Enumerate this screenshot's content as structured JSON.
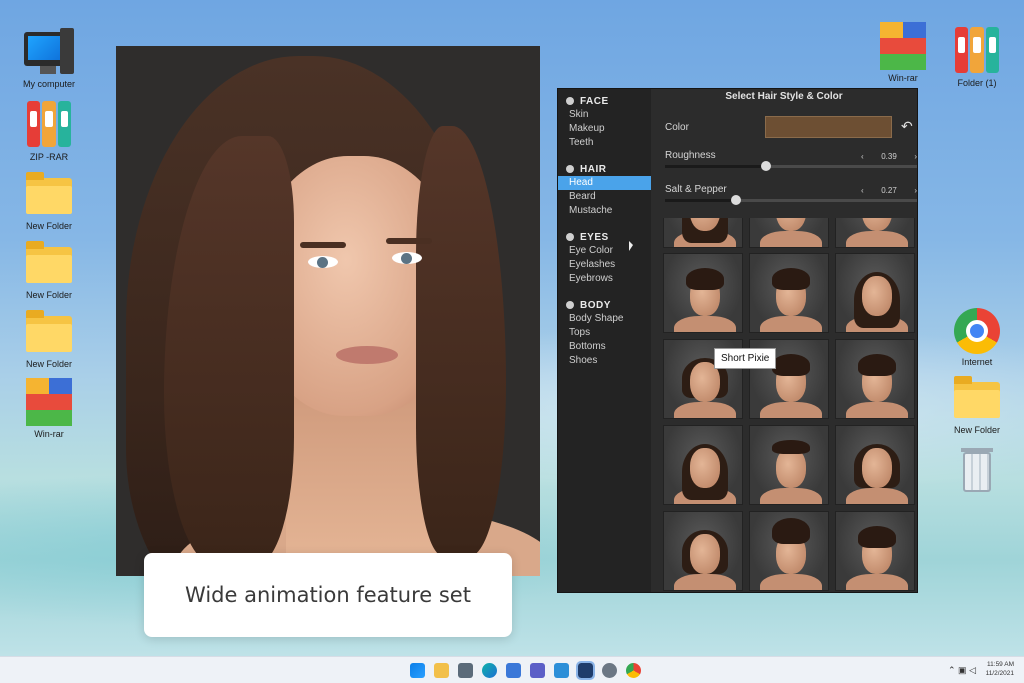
{
  "desktop": {
    "icons_left": [
      {
        "label": "My computer",
        "icon": "computer-icon"
      },
      {
        "label": "ZIP -RAR",
        "icon": "archive-books-icon"
      },
      {
        "label": "New Folder",
        "icon": "folder-icon"
      },
      {
        "label": "New Folder",
        "icon": "folder-icon"
      },
      {
        "label": "New Folder",
        "icon": "folder-icon"
      },
      {
        "label": "Win-rar",
        "icon": "winrar-icon"
      }
    ],
    "icons_right": [
      {
        "label": "Win-rar",
        "icon": "winrar-icon"
      },
      {
        "label": "Folder (1)",
        "icon": "archive-books-icon"
      },
      {
        "label": "Internet",
        "icon": "chrome-icon"
      },
      {
        "label": "New Folder",
        "icon": "folder-icon"
      },
      {
        "label": "",
        "icon": "recycle-bin-icon"
      }
    ]
  },
  "caption": "Wide animation feature set",
  "app": {
    "title": "Select Hair Style & Color",
    "sections": [
      {
        "title": "FACE",
        "items": [
          "Skin",
          "Makeup",
          "Teeth"
        ]
      },
      {
        "title": "HAIR",
        "items": [
          "Head",
          "Beard",
          "Mustache"
        ]
      },
      {
        "title": "EYES",
        "items": [
          "Eye Color",
          "Eyelashes",
          "Eyebrows"
        ]
      },
      {
        "title": "BODY",
        "items": [
          "Body Shape",
          "Tops",
          "Bottoms",
          "Shoes"
        ]
      }
    ],
    "selected_item": "Head",
    "color_label": "Color",
    "color_value": "#6d4f33",
    "sliders": [
      {
        "label": "Roughness",
        "value": "0.39"
      },
      {
        "label": "Salt & Pepper",
        "value": "0.27"
      }
    ],
    "tooltip": "Short Pixie"
  },
  "taskbar": {
    "time": "11:59 AM",
    "date": "11/2/2021"
  },
  "colors": {
    "accent": "#4aa3ea",
    "window_bg": "#2c2c2c",
    "sidebar_bg": "#232323"
  }
}
